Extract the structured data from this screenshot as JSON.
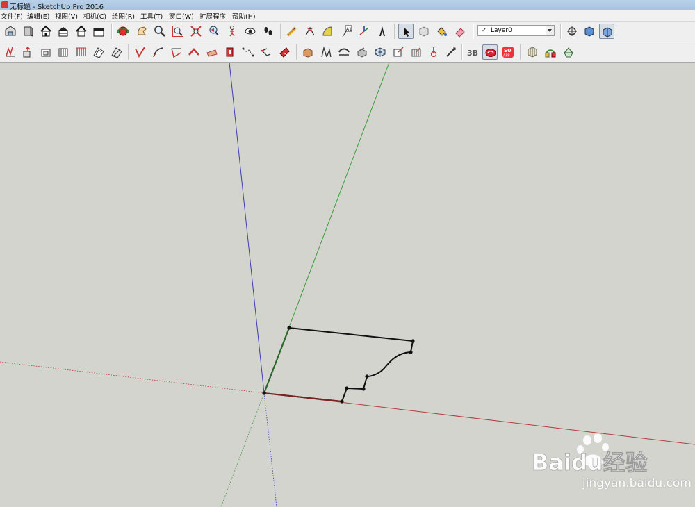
{
  "window": {
    "title": "无标题 - SketchUp Pro 2016"
  },
  "menu": [
    {
      "label": "文件(F)"
    },
    {
      "label": "编辑(E)"
    },
    {
      "label": "视图(V)"
    },
    {
      "label": "相机(C)"
    },
    {
      "label": "绘图(R)"
    },
    {
      "label": "工具(T)"
    },
    {
      "label": "窗口(W)"
    },
    {
      "label": "扩展程序"
    },
    {
      "label": "帮助(H)"
    }
  ],
  "layer": {
    "check": "✓",
    "current": "Layer0"
  },
  "tools_row1": [
    "iso-view",
    "front-view",
    "house-view",
    "top-view",
    "back-view",
    "right-view",
    "orbit",
    "pan",
    "zoom",
    "zoom-window",
    "zoom-extents",
    "previous-view",
    "position-camera",
    "look-around",
    "walk",
    "tape-measure",
    "dimension",
    "protractor",
    "text",
    "axes",
    "3d-text",
    "select",
    "component",
    "paint-bucket",
    "eraser",
    "section-plane",
    "display-section-planes",
    "display-section-cuts"
  ],
  "tools_row2": [
    "move",
    "push-pull",
    "rotate",
    "follow-me",
    "scale",
    "offset",
    "line",
    "arc",
    "freehand",
    "rectangle",
    "circle",
    "polygon",
    "eraser-2",
    "unfold",
    "sandbox-a",
    "sandbox-b",
    "sandbox-c",
    "sandbox-d",
    "sandbox-e",
    "sandbox-f",
    "sandbox-g",
    "sandbox-h",
    "sandbox-i",
    "warehouse-3d",
    "extension-warehouse",
    "su-app",
    "dynamic-component-a",
    "dynamic-component-b",
    "dynamic-component-c"
  ],
  "watermark": {
    "brand": "Baidu经验",
    "url": "jingyan.baidu.com"
  },
  "colors": {
    "canvas": "#d4d4cf",
    "axis_red": "#b53a3a",
    "axis_green": "#3b9b3b",
    "axis_blue": "#3d3db5"
  }
}
